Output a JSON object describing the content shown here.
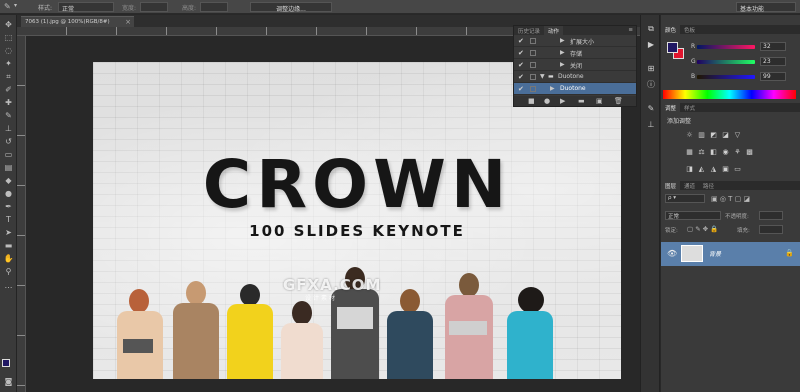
{
  "options_bar": {
    "tool_preset_icon": "brush-icon",
    "style_label": "样式:",
    "style_value": "正常",
    "width_label": "宽度:",
    "height_label": "高度:",
    "refine_button": "调整边缘...",
    "workspace": "基本功能"
  },
  "document": {
    "tab_title": "7063 (1).jpg @ 100%(RGB/8#)",
    "close_icon": "×"
  },
  "canvas": {
    "title": "CROWN",
    "subtitle": "100 SLIDES KEYNOTE",
    "watermark": "GFXA.COM",
    "watermark_sub": "设计素材"
  },
  "history_panel": {
    "tabs": [
      "历史记录",
      "动作"
    ],
    "active_tab": "动作",
    "rows": [
      {
        "label": "扩展大小",
        "indent": 2,
        "selected": false
      },
      {
        "label": "存储",
        "indent": 2,
        "selected": false
      },
      {
        "label": "关闭",
        "indent": 2,
        "selected": false
      },
      {
        "label": "Duotone",
        "indent": 1,
        "selected": false
      },
      {
        "label": "Duotone",
        "indent": 2,
        "selected": true
      }
    ]
  },
  "color_panel": {
    "tabs": [
      "颜色",
      "色板"
    ],
    "channels": [
      {
        "label": "R",
        "value": "32"
      },
      {
        "label": "G",
        "value": "23"
      },
      {
        "label": "B",
        "value": "99"
      }
    ],
    "foreground": "#201763",
    "background": "#e0152e"
  },
  "adjustments_panel": {
    "tabs": [
      "调整",
      "样式"
    ],
    "heading": "添加调整"
  },
  "layers_panel": {
    "tabs": [
      "图层",
      "通道",
      "路径"
    ],
    "blend_mode": "正常",
    "opacity_label": "不透明度:",
    "lock_label": "锁定:",
    "fill_label": "填充:",
    "layer_name": "背景"
  },
  "colors": {
    "selection_blue": "#4a6e99",
    "panel_dark": "#3a3a3a"
  }
}
